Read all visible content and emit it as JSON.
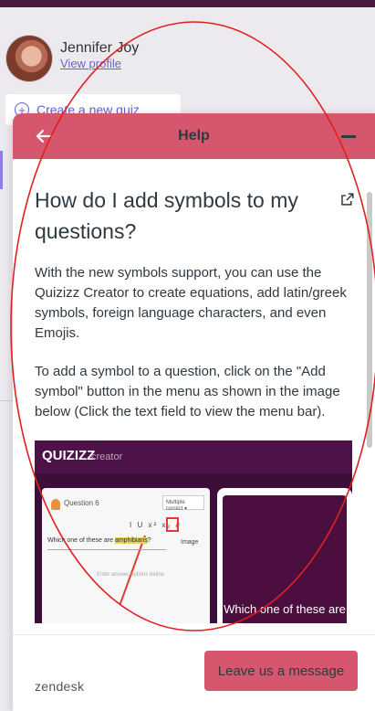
{
  "profile": {
    "name": "Jennifer Joy",
    "view_profile": "View profile"
  },
  "sidebar": {
    "create_quiz": "Create a new quiz"
  },
  "help_widget": {
    "header": {
      "title": "Help"
    },
    "article": {
      "title": "How do I add symbols to my questions?",
      "paragraphs": [
        "With the new symbols support, you can use the Quizizz Creator to create equations, add latin/greek symbols, foreign language characters, and even Emojis.",
        "To add a symbol to a question, click on the \"Add symbol\" button in the menu as shown in the image below (Click the text field to view the menu bar)."
      ],
      "image": {
        "logo": "QUIZIZZ",
        "logo_sub": "creator",
        "question_label": "Question 6",
        "type_dropdown": "Multiple correct ▾",
        "toolbar": "I U x² x₂ ∂",
        "field_prefix": "Which one of these are ",
        "field_highlight": "amphibians",
        "field_suffix": "?",
        "image_button": "Image",
        "options_hint": "Enter answer options below",
        "preview_text": "Which one of these are"
      }
    },
    "footer": {
      "leave_message": "Leave us a message",
      "brand": "zendesk"
    }
  },
  "colors": {
    "header": "#d5566d",
    "accent": "#6a5fd8",
    "annotation": "#e02020"
  }
}
